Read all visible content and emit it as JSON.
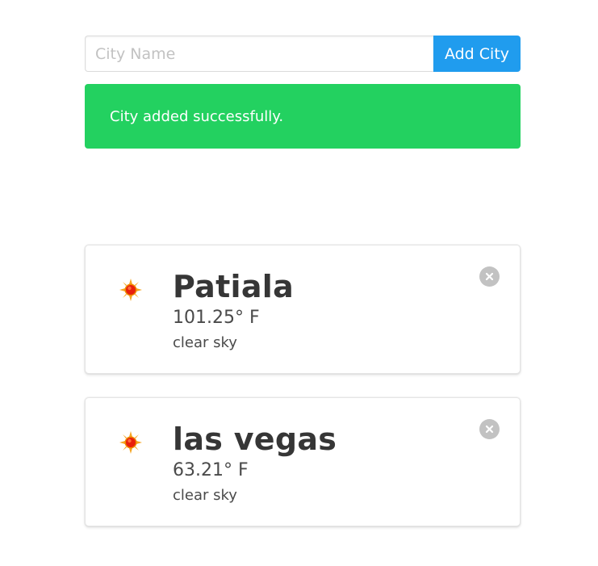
{
  "search": {
    "placeholder": "City Name",
    "value": "",
    "add_label": "Add City"
  },
  "notification": {
    "text": "City added successfully.",
    "color": "#23d160"
  },
  "colors": {
    "primary": "#209cee",
    "success": "#23d160",
    "delete": "#c2c2c2"
  },
  "cities": [
    {
      "name": "Patiala",
      "temperature": "101.25° F",
      "description": "clear sky",
      "icon": "sun-icon"
    },
    {
      "name": "las vegas",
      "temperature": "63.21° F",
      "description": "clear sky",
      "icon": "sun-icon"
    }
  ]
}
